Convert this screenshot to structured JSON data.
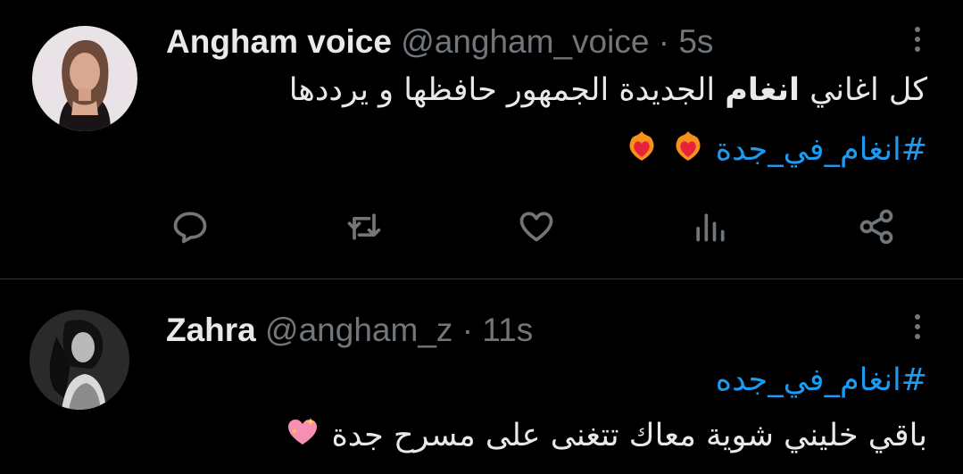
{
  "tweets": [
    {
      "display_name": "Angham voice",
      "handle": "@angham_voice",
      "separator": "·",
      "time": "5s",
      "text_line1_pre": "كل اغاني ",
      "text_line1_bold": "انغام",
      "text_line1_post": " الجديدة الجمهور حافظها و يرددها",
      "hashtag": "#انغام_في_جدة",
      "emojis": [
        "heart-on-fire",
        "heart-on-fire"
      ]
    },
    {
      "display_name": "Zahra",
      "handle": "@angham_z",
      "separator": "·",
      "time": "11s",
      "hashtag": "#انغام_في_جده",
      "text_line2": "باقي خليني شوية معاك تتغنى على مسرح جدة",
      "emojis": [
        "sparkling-heart"
      ]
    }
  ],
  "actions": [
    "reply",
    "retweet",
    "like",
    "views",
    "share"
  ],
  "colors": {
    "background": "#000000",
    "text": "#e7e9ea",
    "muted": "#71767b",
    "link": "#1d9bf0",
    "divider": "#2f3336"
  }
}
